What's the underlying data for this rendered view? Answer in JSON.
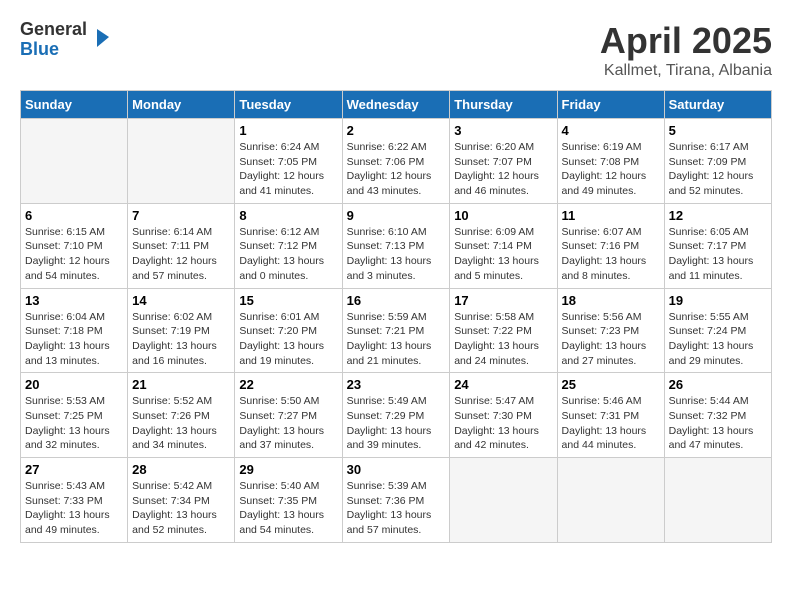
{
  "header": {
    "logo_general": "General",
    "logo_blue": "Blue",
    "title": "April 2025",
    "subtitle": "Kallmet, Tirana, Albania"
  },
  "days_of_week": [
    "Sunday",
    "Monday",
    "Tuesday",
    "Wednesday",
    "Thursday",
    "Friday",
    "Saturday"
  ],
  "weeks": [
    [
      {
        "day": "",
        "info": ""
      },
      {
        "day": "",
        "info": ""
      },
      {
        "day": "1",
        "info": "Sunrise: 6:24 AM\nSunset: 7:05 PM\nDaylight: 12 hours and 41 minutes."
      },
      {
        "day": "2",
        "info": "Sunrise: 6:22 AM\nSunset: 7:06 PM\nDaylight: 12 hours and 43 minutes."
      },
      {
        "day": "3",
        "info": "Sunrise: 6:20 AM\nSunset: 7:07 PM\nDaylight: 12 hours and 46 minutes."
      },
      {
        "day": "4",
        "info": "Sunrise: 6:19 AM\nSunset: 7:08 PM\nDaylight: 12 hours and 49 minutes."
      },
      {
        "day": "5",
        "info": "Sunrise: 6:17 AM\nSunset: 7:09 PM\nDaylight: 12 hours and 52 minutes."
      }
    ],
    [
      {
        "day": "6",
        "info": "Sunrise: 6:15 AM\nSunset: 7:10 PM\nDaylight: 12 hours and 54 minutes."
      },
      {
        "day": "7",
        "info": "Sunrise: 6:14 AM\nSunset: 7:11 PM\nDaylight: 12 hours and 57 minutes."
      },
      {
        "day": "8",
        "info": "Sunrise: 6:12 AM\nSunset: 7:12 PM\nDaylight: 13 hours and 0 minutes."
      },
      {
        "day": "9",
        "info": "Sunrise: 6:10 AM\nSunset: 7:13 PM\nDaylight: 13 hours and 3 minutes."
      },
      {
        "day": "10",
        "info": "Sunrise: 6:09 AM\nSunset: 7:14 PM\nDaylight: 13 hours and 5 minutes."
      },
      {
        "day": "11",
        "info": "Sunrise: 6:07 AM\nSunset: 7:16 PM\nDaylight: 13 hours and 8 minutes."
      },
      {
        "day": "12",
        "info": "Sunrise: 6:05 AM\nSunset: 7:17 PM\nDaylight: 13 hours and 11 minutes."
      }
    ],
    [
      {
        "day": "13",
        "info": "Sunrise: 6:04 AM\nSunset: 7:18 PM\nDaylight: 13 hours and 13 minutes."
      },
      {
        "day": "14",
        "info": "Sunrise: 6:02 AM\nSunset: 7:19 PM\nDaylight: 13 hours and 16 minutes."
      },
      {
        "day": "15",
        "info": "Sunrise: 6:01 AM\nSunset: 7:20 PM\nDaylight: 13 hours and 19 minutes."
      },
      {
        "day": "16",
        "info": "Sunrise: 5:59 AM\nSunset: 7:21 PM\nDaylight: 13 hours and 21 minutes."
      },
      {
        "day": "17",
        "info": "Sunrise: 5:58 AM\nSunset: 7:22 PM\nDaylight: 13 hours and 24 minutes."
      },
      {
        "day": "18",
        "info": "Sunrise: 5:56 AM\nSunset: 7:23 PM\nDaylight: 13 hours and 27 minutes."
      },
      {
        "day": "19",
        "info": "Sunrise: 5:55 AM\nSunset: 7:24 PM\nDaylight: 13 hours and 29 minutes."
      }
    ],
    [
      {
        "day": "20",
        "info": "Sunrise: 5:53 AM\nSunset: 7:25 PM\nDaylight: 13 hours and 32 minutes."
      },
      {
        "day": "21",
        "info": "Sunrise: 5:52 AM\nSunset: 7:26 PM\nDaylight: 13 hours and 34 minutes."
      },
      {
        "day": "22",
        "info": "Sunrise: 5:50 AM\nSunset: 7:27 PM\nDaylight: 13 hours and 37 minutes."
      },
      {
        "day": "23",
        "info": "Sunrise: 5:49 AM\nSunset: 7:29 PM\nDaylight: 13 hours and 39 minutes."
      },
      {
        "day": "24",
        "info": "Sunrise: 5:47 AM\nSunset: 7:30 PM\nDaylight: 13 hours and 42 minutes."
      },
      {
        "day": "25",
        "info": "Sunrise: 5:46 AM\nSunset: 7:31 PM\nDaylight: 13 hours and 44 minutes."
      },
      {
        "day": "26",
        "info": "Sunrise: 5:44 AM\nSunset: 7:32 PM\nDaylight: 13 hours and 47 minutes."
      }
    ],
    [
      {
        "day": "27",
        "info": "Sunrise: 5:43 AM\nSunset: 7:33 PM\nDaylight: 13 hours and 49 minutes."
      },
      {
        "day": "28",
        "info": "Sunrise: 5:42 AM\nSunset: 7:34 PM\nDaylight: 13 hours and 52 minutes."
      },
      {
        "day": "29",
        "info": "Sunrise: 5:40 AM\nSunset: 7:35 PM\nDaylight: 13 hours and 54 minutes."
      },
      {
        "day": "30",
        "info": "Sunrise: 5:39 AM\nSunset: 7:36 PM\nDaylight: 13 hours and 57 minutes."
      },
      {
        "day": "",
        "info": ""
      },
      {
        "day": "",
        "info": ""
      },
      {
        "day": "",
        "info": ""
      }
    ]
  ]
}
